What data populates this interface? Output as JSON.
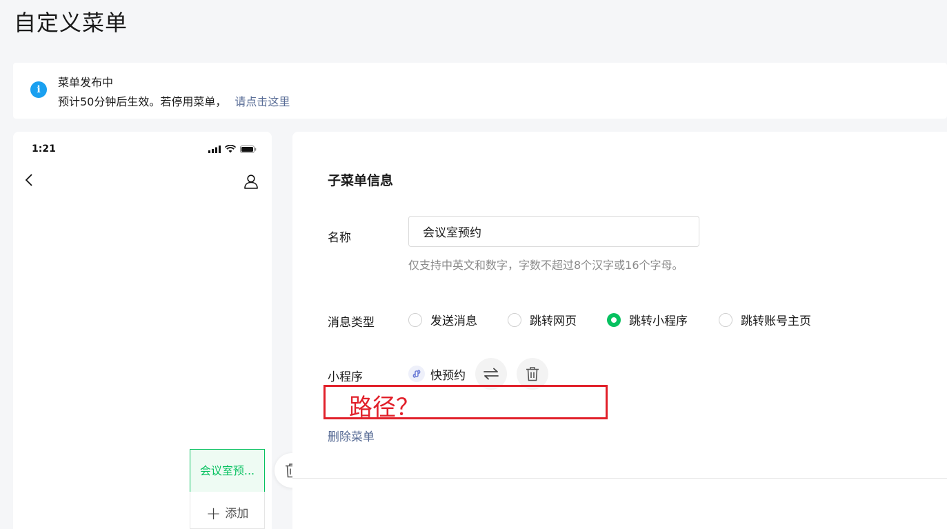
{
  "page": {
    "title": "自定义菜单"
  },
  "notice": {
    "title": "菜单发布中",
    "message": "预计50分钟后生效。若停用菜单，",
    "link": "请点击这里",
    "icon_color": "#1aa0f0"
  },
  "phone": {
    "time": "1:21",
    "menu_item": "会议室预...",
    "add_label": "添加"
  },
  "form": {
    "section_title": "子菜单信息",
    "name_label": "名称",
    "name_value": "会议室预约",
    "name_hint": "仅支持中英文和数字，字数不超过8个汉字或16个字母。",
    "type_label": "消息类型",
    "options": [
      {
        "label": "发送消息",
        "checked": false
      },
      {
        "label": "跳转网页",
        "checked": false
      },
      {
        "label": "跳转小程序",
        "checked": true
      },
      {
        "label": "跳转账号主页",
        "checked": false
      }
    ],
    "miniprogram_label": "小程序",
    "miniprogram_name": "快预约",
    "delete_menu": "删除菜单"
  },
  "annotation": {
    "text": "路径？",
    "color": "#e1202a"
  },
  "colors": {
    "accent": "#07c160",
    "link": "#576b95"
  }
}
